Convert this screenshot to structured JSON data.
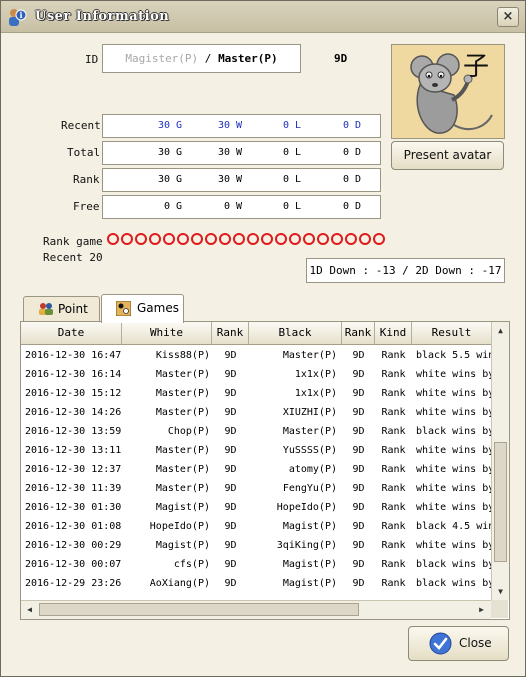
{
  "window": {
    "title": "User Information",
    "close_glyph": "×"
  },
  "user": {
    "id_label": "ID",
    "id_prefix": "Magister(P)",
    "id_separator": " / ",
    "id_current": "Master(P)",
    "rank": "9D"
  },
  "avatar": {
    "character": "子",
    "button_label": "Present avatar"
  },
  "stats": [
    {
      "label": "Recent",
      "games": "30 G",
      "wins": "30 W",
      "losses": "0 L",
      "draws": "0 D",
      "highlight": true
    },
    {
      "label": "Total",
      "games": "30 G",
      "wins": "30 W",
      "losses": "0 L",
      "draws": "0 D",
      "highlight": false
    },
    {
      "label": "Rank",
      "games": "30 G",
      "wins": "30 W",
      "losses": "0 L",
      "draws": "0 D",
      "highlight": false
    },
    {
      "label": "Free",
      "games": "0 G",
      "wins": "0 W",
      "losses": "0 L",
      "draws": "0 D",
      "highlight": false
    }
  ],
  "recent_rank": {
    "label_line1": "Rank game",
    "label_line2": "Recent 20",
    "result_count": 20,
    "down_text": "1D Down : -13 / 2D Down : -17"
  },
  "tabs": [
    {
      "label": "Point",
      "icon": "players-icon"
    },
    {
      "label": "Games",
      "icon": "board-icon"
    }
  ],
  "games_table": {
    "columns": [
      "Date",
      "White",
      "Rank",
      "Black",
      "Rank",
      "Kind",
      "Result"
    ],
    "rows": [
      [
        "2016-12-30 16:47",
        "Kiss88(P)",
        "9D",
        "Master(P)",
        "9D",
        "Rank",
        "black 5.5 wins"
      ],
      [
        "2016-12-30 16:14",
        "Master(P)",
        "9D",
        "1x1x(P)",
        "9D",
        "Rank",
        "white wins by"
      ],
      [
        "2016-12-30 15:12",
        "Master(P)",
        "9D",
        "1x1x(P)",
        "9D",
        "Rank",
        "white wins by"
      ],
      [
        "2016-12-30 14:26",
        "Master(P)",
        "9D",
        "XIUZHI(P)",
        "9D",
        "Rank",
        "white wins by"
      ],
      [
        "2016-12-30 13:59",
        "Chop(P)",
        "9D",
        "Master(P)",
        "9D",
        "Rank",
        "black wins by"
      ],
      [
        "2016-12-30 13:11",
        "Master(P)",
        "9D",
        "YuSSSS(P)",
        "9D",
        "Rank",
        "white wins by"
      ],
      [
        "2016-12-30 12:37",
        "Master(P)",
        "9D",
        "atomy(P)",
        "9D",
        "Rank",
        "white wins by"
      ],
      [
        "2016-12-30 11:39",
        "Master(P)",
        "9D",
        "FengYu(P)",
        "9D",
        "Rank",
        "white wins by"
      ],
      [
        "2016-12-30 01:30",
        "Magist(P)",
        "9D",
        "HopeIdo(P)",
        "9D",
        "Rank",
        "white wins by"
      ],
      [
        "2016-12-30 01:08",
        "HopeIdo(P)",
        "9D",
        "Magist(P)",
        "9D",
        "Rank",
        "black 4.5 wins"
      ],
      [
        "2016-12-30 00:29",
        "Magist(P)",
        "9D",
        "3qiKing(P)",
        "9D",
        "Rank",
        "white wins by"
      ],
      [
        "2016-12-30 00:07",
        "cfs(P)",
        "9D",
        "Magist(P)",
        "9D",
        "Rank",
        "black wins by"
      ],
      [
        "2016-12-29 23:26",
        "AoXiang(P)",
        "9D",
        "Magist(P)",
        "9D",
        "Rank",
        "black wins by"
      ]
    ]
  },
  "close_button": {
    "label": "Close"
  },
  "colors": {
    "accent_blue": "#1d2fc0",
    "loss_circle": "#e01b1b"
  }
}
